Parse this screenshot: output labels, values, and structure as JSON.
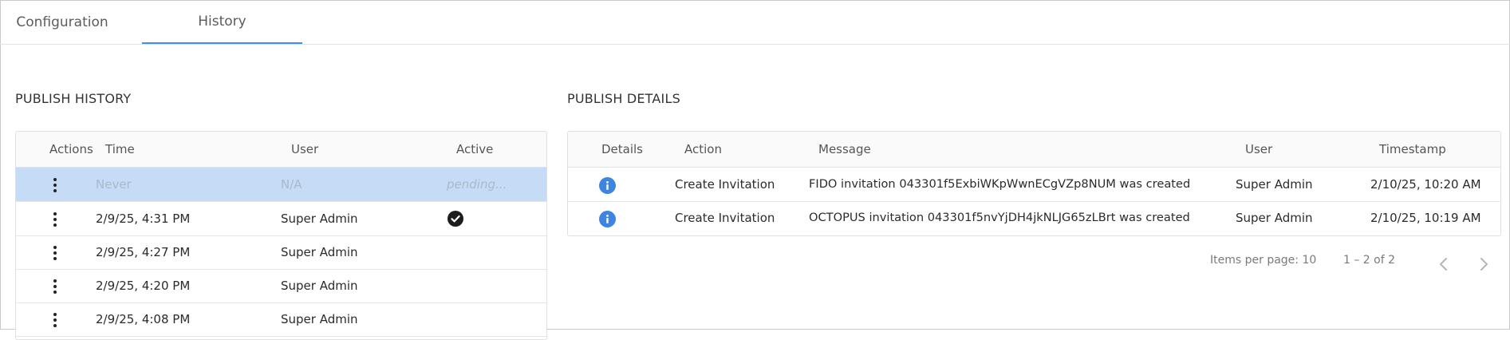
{
  "tabs": [
    {
      "label": "Configuration",
      "active": false
    },
    {
      "label": "History",
      "active": true
    }
  ],
  "publish_history": {
    "title": "PUBLISH HISTORY",
    "columns": [
      "Actions",
      "Time",
      "User",
      "Active"
    ],
    "pending_row": {
      "time": "Never",
      "user": "N/A",
      "active": "pending..."
    },
    "rows": [
      {
        "time": "2/9/25, 4:31 PM",
        "user": "Super Admin",
        "active": true
      },
      {
        "time": "2/9/25, 4:27 PM",
        "user": "Super Admin",
        "active": false
      },
      {
        "time": "2/9/25, 4:20 PM",
        "user": "Super Admin",
        "active": false
      },
      {
        "time": "2/9/25, 4:08 PM",
        "user": "Super Admin",
        "active": false
      }
    ]
  },
  "publish_details": {
    "title": "PUBLISH DETAILS",
    "columns": [
      "Details",
      "Action",
      "Message",
      "User",
      "Timestamp"
    ],
    "rows": [
      {
        "action": "Create Invitation",
        "message": "FIDO invitation 043301f5ExbiWKpWwnECgVZp8NUM was created",
        "user": "Super Admin",
        "timestamp": "2/10/25, 10:20 AM"
      },
      {
        "action": "Create Invitation",
        "message": "OCTOPUS invitation 043301f5nvYjDH4jkNLJG65zLBrt was created",
        "user": "Super Admin",
        "timestamp": "2/10/25, 10:19 AM"
      }
    ],
    "paginator": {
      "items_per_page_label": "Items per page:",
      "items_per_page": "10",
      "range": "1 – 2 of 2"
    }
  },
  "colors": {
    "accent": "#3d8bfd",
    "selected_row": "#c6dbf6",
    "info_icon": "#3d85e0"
  }
}
